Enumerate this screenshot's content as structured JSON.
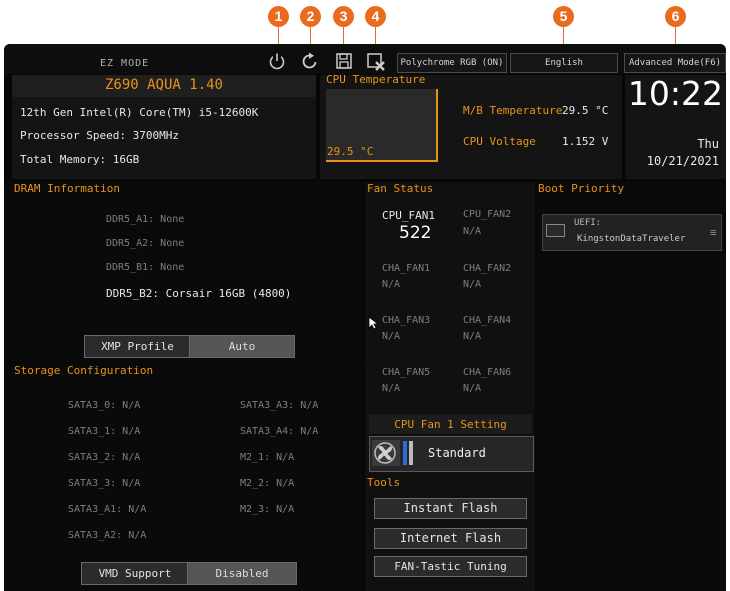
{
  "callouts": [
    "1",
    "2",
    "3",
    "4",
    "5",
    "6"
  ],
  "header": {
    "mode": "EZ MODE",
    "polychrome": "Polychrome RGB (ON)",
    "language": "English",
    "advanced": "Advanced Mode(F6)"
  },
  "sysinfo": {
    "model": "Z690 AQUA 1.40",
    "cpu": "12th Gen Intel(R) Core(TM) i5-12600K",
    "speed": "Processor Speed: 3700MHz",
    "memory": "Total Memory: 16GB"
  },
  "cpu_temp": {
    "title": "CPU Temperature",
    "value": "29.5 °C"
  },
  "mb": {
    "label": "M/B Temperature",
    "value": "29.5 °C",
    "volt_label": "CPU Voltage",
    "volt_value": "1.152 V"
  },
  "clock": {
    "time": "10:22",
    "day": "Thu",
    "date": "10/21/2021"
  },
  "dram": {
    "title": "DRAM Information",
    "slots": [
      "DDR5_A1: None",
      "DDR5_A2: None",
      "DDR5_B1: None",
      "DDR5_B2: Corsair 16GB (4800)"
    ],
    "xmp_label": "XMP Profile",
    "xmp_value": "Auto"
  },
  "storage": {
    "title": "Storage Configuration",
    "left": [
      "SATA3_0: N/A",
      "SATA3_1: N/A",
      "SATA3_2: N/A",
      "SATA3_3: N/A",
      "SATA3_A1: N/A",
      "SATA3_A2: N/A"
    ],
    "right": [
      "SATA3_A3: N/A",
      "SATA3_A4: N/A",
      "M2_1: N/A",
      "M2_2: N/A",
      "M2_3: N/A"
    ],
    "vmd_label": "VMD Support",
    "vmd_value": "Disabled"
  },
  "fan": {
    "title": "Fan Status",
    "fans": [
      {
        "name": "CPU_FAN1",
        "value": "522"
      },
      {
        "name": "CPU_FAN2",
        "value": "N/A"
      },
      {
        "name": "CHA_FAN1",
        "value": "N/A"
      },
      {
        "name": "CHA_FAN2",
        "value": "N/A"
      },
      {
        "name": "CHA_FAN3",
        "value": "N/A"
      },
      {
        "name": "CHA_FAN4",
        "value": "N/A"
      },
      {
        "name": "CHA_FAN5",
        "value": "N/A"
      },
      {
        "name": "CHA_FAN6",
        "value": "N/A"
      }
    ],
    "setting_title": "CPU Fan 1 Setting",
    "setting_value": "Standard"
  },
  "tools": {
    "title": "Tools",
    "items": [
      "Instant Flash",
      "Internet Flash",
      "FAN-Tastic Tuning"
    ]
  },
  "boot": {
    "title": "Boot Priority",
    "entry_line1": "UEFI:",
    "entry_line2": "KingstonDataTraveler"
  },
  "colors": {
    "accent": "#e9921a",
    "callout": "#ea6a1e",
    "background": "#070707"
  }
}
